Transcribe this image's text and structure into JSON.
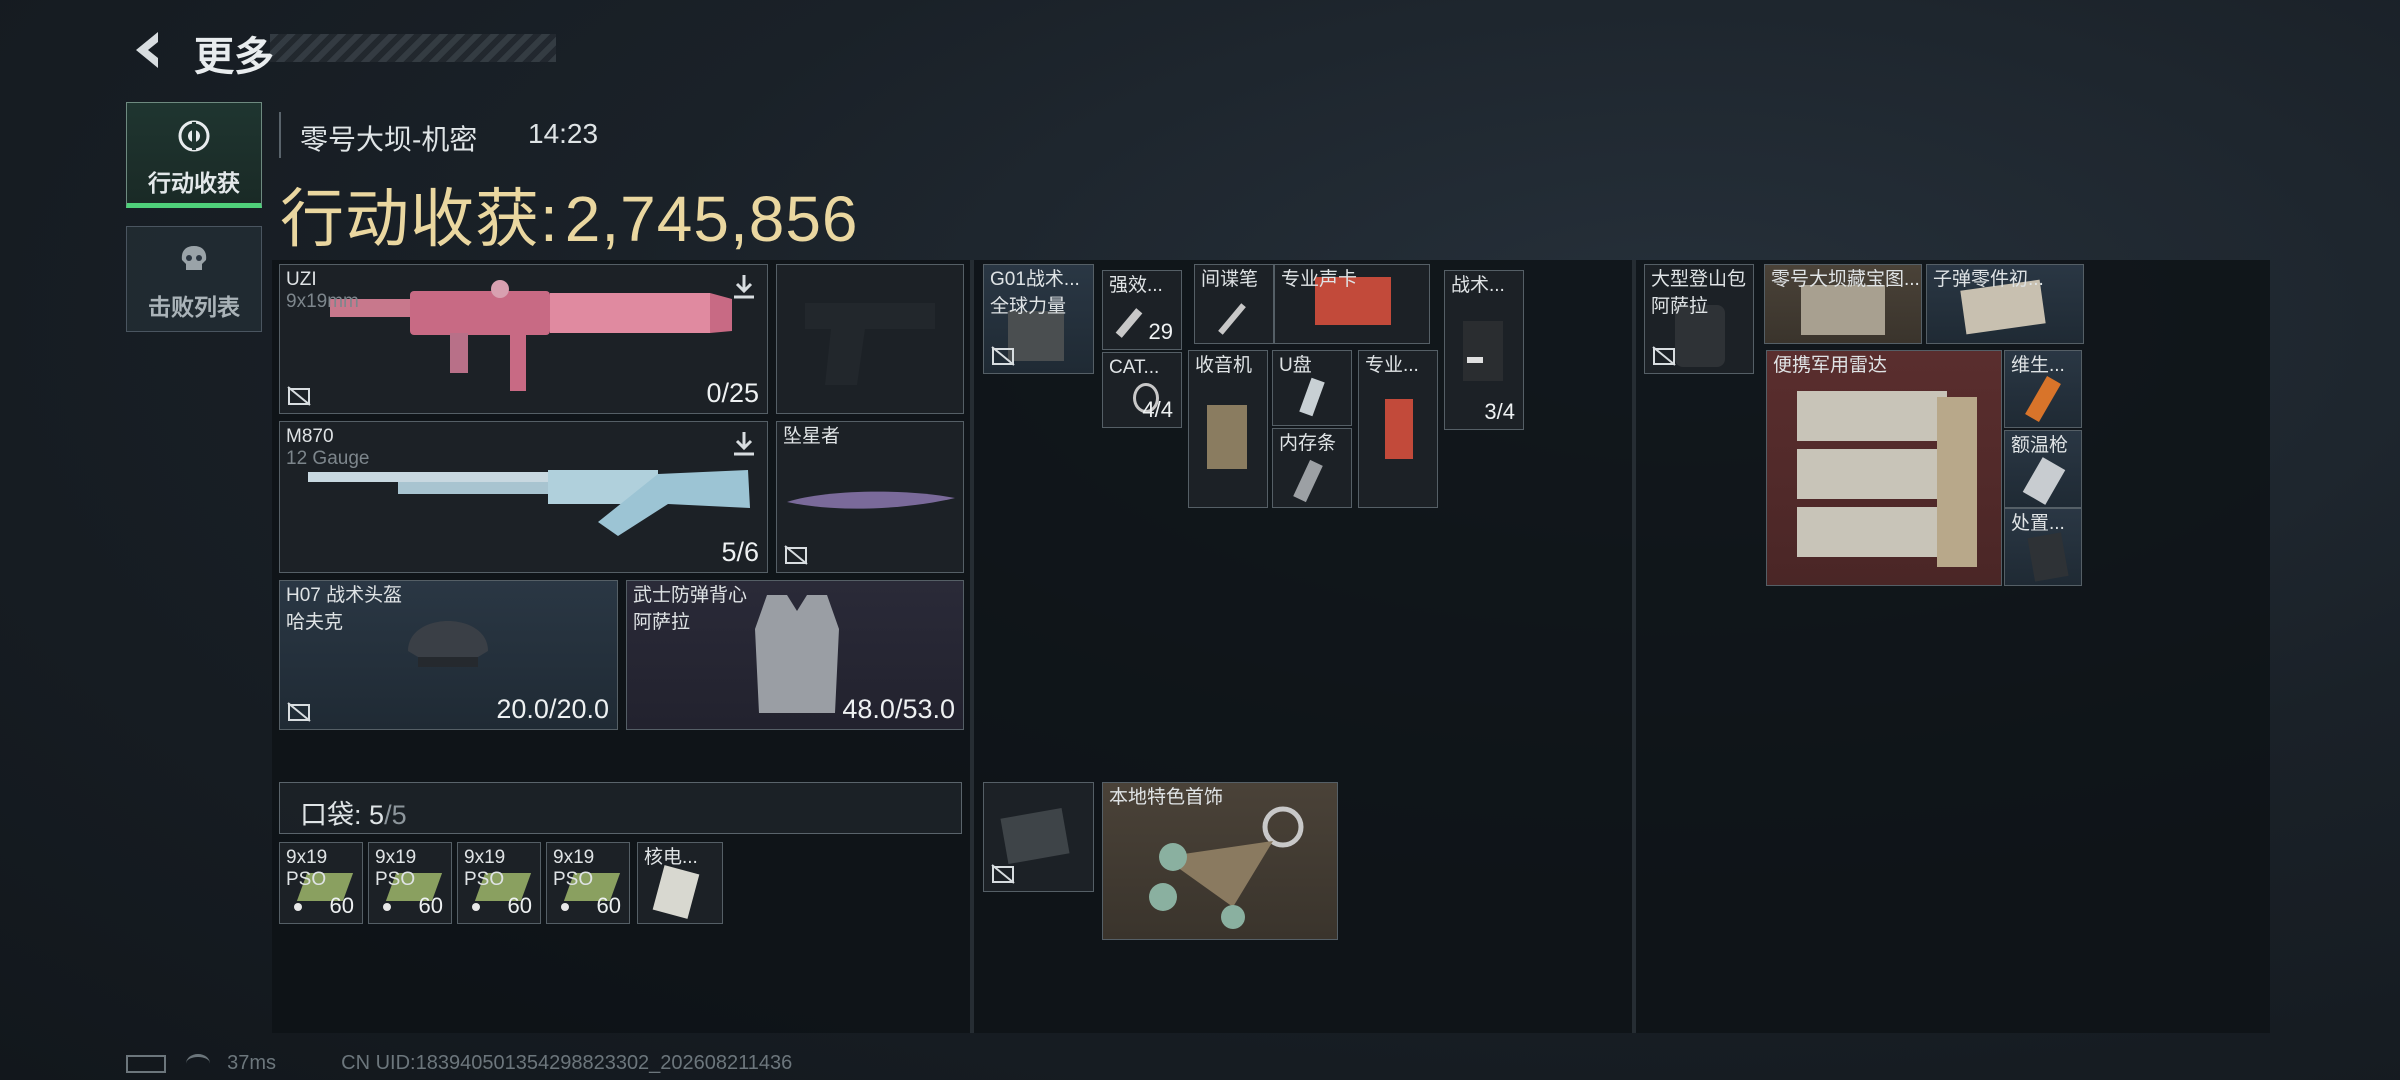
{
  "header": {
    "title": "更多"
  },
  "tabs": [
    {
      "label": "行动收获",
      "icon": "eye-target-icon"
    },
    {
      "label": "击败列表",
      "icon": "skull-icon"
    }
  ],
  "match": {
    "map": "零号大坝-机密",
    "time": "14:23"
  },
  "reward": {
    "label": "行动收获:",
    "value": "2,745,856",
    "color": "#ead7a0"
  },
  "weapons": [
    {
      "name": "UZI",
      "caliber": "9x19mm",
      "ammo": "0/25"
    },
    {
      "name": "M870",
      "caliber": "12 Gauge",
      "ammo": "5/6"
    },
    {
      "name": "坠星者"
    }
  ],
  "armor": [
    {
      "name": "H07 战术头盔",
      "brand": "哈夫克",
      "durability": "20.0/20.0"
    },
    {
      "name": "武士防弹背心",
      "brand": "阿萨拉",
      "durability": "48.0/53.0"
    }
  ],
  "pocket": {
    "label": "口袋:",
    "used": "5",
    "max": "/5"
  },
  "pocket_items": [
    {
      "name": "9x19",
      "sub": "PSO",
      "count": "60"
    },
    {
      "name": "9x19",
      "sub": "PSO",
      "count": "60"
    },
    {
      "name": "9x19",
      "sub": "PSO",
      "count": "60"
    },
    {
      "name": "9x19",
      "sub": "PSO",
      "count": "60"
    },
    {
      "name": "核电..."
    }
  ],
  "rig": {
    "vest": {
      "name": "G01战术...",
      "sub": "全球力量"
    },
    "items": [
      {
        "name": "强效...",
        "count": "29"
      },
      {
        "name": "CAT...",
        "count": "4/4"
      },
      {
        "name": "间谍笔"
      },
      {
        "name": "专业声卡"
      },
      {
        "name": "战术...",
        "count": "3/4"
      },
      {
        "name": "收音机"
      },
      {
        "name": "U盘"
      },
      {
        "name": "专业..."
      },
      {
        "name": "内存条"
      }
    ]
  },
  "extra": {
    "charm": {
      "name": "本地特色首饰"
    }
  },
  "backpack": {
    "bag": {
      "name": "大型登山包",
      "sub": "阿萨拉"
    },
    "items": [
      {
        "name": "零号大坝藏宝图..."
      },
      {
        "name": "子弹零件初..."
      },
      {
        "name": "便携军用雷达"
      },
      {
        "name": "维生..."
      },
      {
        "name": "额温枪"
      },
      {
        "name": "处置..."
      }
    ]
  },
  "footer": {
    "ping": "37ms",
    "uid": "CN UID:18394050135429882330​2_202608211436"
  }
}
